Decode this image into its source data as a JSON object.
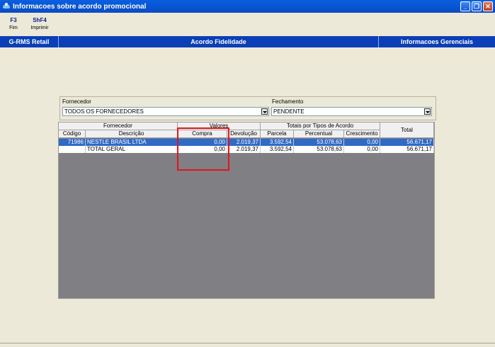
{
  "window": {
    "title": "Informacoes sobre acordo promocional"
  },
  "toolbar": [
    {
      "key": "F3",
      "label": "Fim"
    },
    {
      "key": "ShF4",
      "label": "Imprimir"
    }
  ],
  "nav": {
    "left": "G-RMS Retail",
    "center": "Acordo Fidelidade",
    "right": "Informacoes Gerenciais"
  },
  "filters": {
    "fornecedor": {
      "label": "Fornecedor",
      "value": "TODOS OS FORNECEDORES"
    },
    "fechamento": {
      "label": "Fechamento",
      "value": "PENDENTE"
    }
  },
  "grid": {
    "groups": {
      "fornecedor": "Fornecedor",
      "valores": "Valores",
      "totais": "Totais por Tipos de Acordo",
      "total": "Total"
    },
    "columns": [
      "Código",
      "Descrição",
      "Compra",
      "Devolução",
      "Parcela",
      "Percentual",
      "Crescimento"
    ],
    "rows": [
      {
        "codigo": "71986",
        "descricao": "NESTLE BRASIL LTDA",
        "compra": "0,00",
        "devolucao": "2.019,37",
        "parcela": "3.592,54",
        "percentual": "53.078,63",
        "crescimento": "0,00",
        "total": "56.671,17"
      },
      {
        "codigo": "",
        "descricao": "TOTAL GERAL",
        "compra": "0,00",
        "devolucao": "2.019,37",
        "parcela": "3.592,54",
        "percentual": "53.078,63",
        "crescimento": "0,00",
        "total": "56.671,17"
      }
    ]
  }
}
